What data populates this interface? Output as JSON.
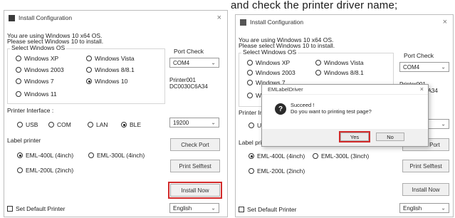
{
  "caption": "and check the printer driver name;",
  "left": {
    "title": "Install Configuration",
    "close": "×",
    "intro_line1": "You are using Windows 10 x64 OS.",
    "intro_line2": "Please select Windows 10 to install.",
    "select_windows_label": "Select Windows OS",
    "os_options": [
      {
        "label": "Windows XP",
        "selected": false
      },
      {
        "label": "Windows Vista",
        "selected": false
      },
      {
        "label": "Windows 2003",
        "selected": false
      },
      {
        "label": "Windows 8/8.1",
        "selected": false
      },
      {
        "label": "Windows 7",
        "selected": false
      },
      {
        "label": "Windows 10",
        "selected": true
      },
      {
        "label": "Windows 11",
        "selected": false
      }
    ],
    "port_check_label": "Port Check",
    "port_value": "COM4",
    "printer_line1": "Printer001",
    "printer_line2": "DC0030C6A34",
    "printer_interface_label": "Printer Interface :",
    "interfaces": [
      {
        "label": "USB",
        "selected": false
      },
      {
        "label": "COM",
        "selected": false
      },
      {
        "label": "LAN",
        "selected": false
      },
      {
        "label": "BLE",
        "selected": true
      }
    ],
    "baud_value": "19200",
    "label_printer_label": "Label printer",
    "printers": [
      {
        "label": "EML-400L (4inch)",
        "selected": true
      },
      {
        "label": "EML-300L (4inch)",
        "selected": false
      },
      {
        "label": "EML-200L (2inch)",
        "selected": false
      }
    ],
    "check_port_button": "Check Port",
    "print_selftest_button": "Print Selftest",
    "install_now_button": "Install Now",
    "set_default_label": "Set Default Printer",
    "language_value": "English"
  },
  "right": {
    "title": "Install Configuration",
    "close": "×",
    "intro_line1": "You are using Windows 10 x64 OS.",
    "intro_line2": "Please select Windows 10 to install.",
    "select_windows_label": "Select Windows OS",
    "os_options": [
      {
        "label": "Windows XP",
        "selected": false
      },
      {
        "label": "Windows Vista",
        "selected": false
      },
      {
        "label": "Windows 2003",
        "selected": false
      },
      {
        "label": "Windows 8/8.1",
        "selected": false
      },
      {
        "label": "Windows 7",
        "selected": false
      },
      {
        "label": "Windows 10",
        "selected": false
      },
      {
        "label": "Windows 11",
        "selected": false
      }
    ],
    "port_check_label": "Port Check",
    "port_value": "COM4",
    "printer_line1": "Printer001",
    "printer_line2": "DC0030C6A34",
    "printer_interface_label": "Printer Interface :",
    "interfaces": [
      {
        "label": "USB",
        "selected": false
      }
    ],
    "baud_value": "200",
    "label_printer_label": "Label printer",
    "printers": [
      {
        "label": "EML-400L (4inch)",
        "selected": true
      },
      {
        "label": "EML-300L (3inch)",
        "selected": false
      },
      {
        "label": "EML-200L (2inch)",
        "selected": false
      }
    ],
    "check_port_button": "Check Port",
    "print_selftest_button": "Print Selftest",
    "install_now_button": "Install Now",
    "set_default_label": "Set Default Printer",
    "language_value": "English",
    "dialog": {
      "title": "EMLabelDriver",
      "close": "×",
      "message_line1": "Succeed !",
      "message_line2": "Do you want to printing test page?",
      "yes_button": "Yes",
      "no_button": "No"
    }
  },
  "colors": {
    "highlight": "#d22b2b",
    "border": "#bdbdbd"
  },
  "icons": [
    "app-icon",
    "close-icon",
    "question-icon",
    "chevron-down-icon"
  ]
}
